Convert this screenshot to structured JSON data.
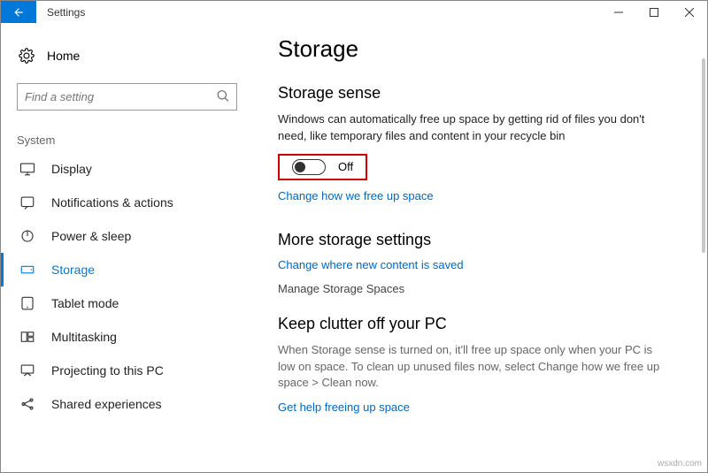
{
  "window": {
    "title": "Settings"
  },
  "sidebar": {
    "home": "Home",
    "search_placeholder": "Find a setting",
    "category": "System",
    "items": [
      {
        "label": "Display"
      },
      {
        "label": "Notifications & actions"
      },
      {
        "label": "Power & sleep"
      },
      {
        "label": "Storage",
        "selected": true
      },
      {
        "label": "Tablet mode"
      },
      {
        "label": "Multitasking"
      },
      {
        "label": "Projecting to this PC"
      },
      {
        "label": "Shared experiences"
      }
    ]
  },
  "page": {
    "title": "Storage",
    "sense": {
      "heading": "Storage sense",
      "desc": "Windows can automatically free up space by getting rid of files you don't need, like temporary files and content in your recycle bin",
      "toggle_state": "Off",
      "link": "Change how we free up space"
    },
    "more": {
      "heading": "More storage settings",
      "link": "Change where new content is saved",
      "manage": "Manage Storage Spaces"
    },
    "clutter": {
      "heading": "Keep clutter off your PC",
      "desc": "When Storage sense is turned on, it'll free up space only when your PC is low on space. To clean up unused files now, select Change how we free up space > Clean now.",
      "link": "Get help freeing up space"
    }
  },
  "watermark": "wsxdn.com"
}
